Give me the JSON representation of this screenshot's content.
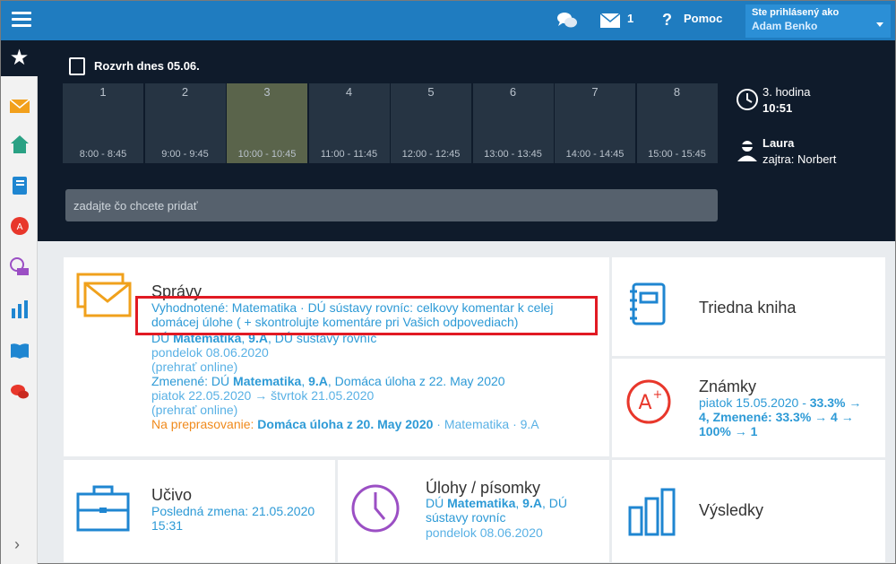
{
  "topbar": {
    "messages_count": "1",
    "help_label": "Pomoc",
    "user_label": "Ste prihlásený ako",
    "user_name": "Adam Benko"
  },
  "schedule": {
    "title": "Rozvrh dnes 05.06.",
    "periods": [
      {
        "num": "1",
        "time": "8:00 - 8:45"
      },
      {
        "num": "2",
        "time": "9:00 - 9:45"
      },
      {
        "num": "3",
        "time": "10:00 - 10:45"
      },
      {
        "num": "4",
        "time": "11:00 - 11:45"
      },
      {
        "num": "5",
        "time": "12:00 - 12:45"
      },
      {
        "num": "6",
        "time": "13:00 - 13:45"
      },
      {
        "num": "7",
        "time": "14:00 - 14:45"
      },
      {
        "num": "8",
        "time": "15:00 - 15:45"
      }
    ],
    "current_hour": "3. hodina",
    "current_time": "10:51",
    "duty_name": "Laura",
    "duty_tomorrow": "zajtra: Norbert"
  },
  "add_input": {
    "placeholder": "zadajte čo chcete pridať"
  },
  "spravy": {
    "title": "Správy",
    "item1": "Vyhodnotené: Matematika · DÚ sústavy rovníc: celkovy komentar k celej domácej úlohe ( + skontrolujte komentáre pri Vašich odpovediach)",
    "item2_prefix": "DÚ ",
    "item2_subject": "Matematika",
    "item2_class": "9.A",
    "item2_suffix": ", DÚ sústavy rovníc",
    "item2_date": "pondelok 08.06.2020",
    "item2_play": "(prehrať online)",
    "item3_prefix": "Zmenené: DÚ ",
    "item3_subject": "Matematika",
    "item3_class": "9.A",
    "item3_suffix": ", Domáca úloha z 22. May 2020",
    "item3_date": "piatok 22.05.2020 → štvrtok 21.05.2020",
    "item3_play": "(prehrať online)",
    "item4_prefix": "Na preprasovanie: ",
    "item4_bold": "Domáca úloha z 20. May 2020",
    "item4_suffix": " · Matematika · 9.A"
  },
  "triedna_kniha": {
    "title": "Triedna kniha"
  },
  "znamky": {
    "title": "Známky",
    "line1": "piatok 15.05.2020 - ",
    "bold1": "33.3% → 4, Zmenené: 33.3% → 4 → 100% → 1"
  },
  "ucivo": {
    "title": "Učivo",
    "line1": "Posledná zmena: 21.05.2020",
    "line2": "15:31"
  },
  "ulohy": {
    "title": "Úlohy / písomky",
    "prefix": "DÚ ",
    "subject": "Matematika",
    "class": "9.A",
    "suffix": ", DÚ sústavy rovníc",
    "date": "pondelok 08.06.2020"
  },
  "vysledky": {
    "title": "Výsledky"
  },
  "colors": {
    "primary": "#1f7cc0",
    "dark": "#0f1b2b",
    "link": "#2d9ad6",
    "highlight": "#e11a23",
    "orange": "#f08a1c"
  }
}
